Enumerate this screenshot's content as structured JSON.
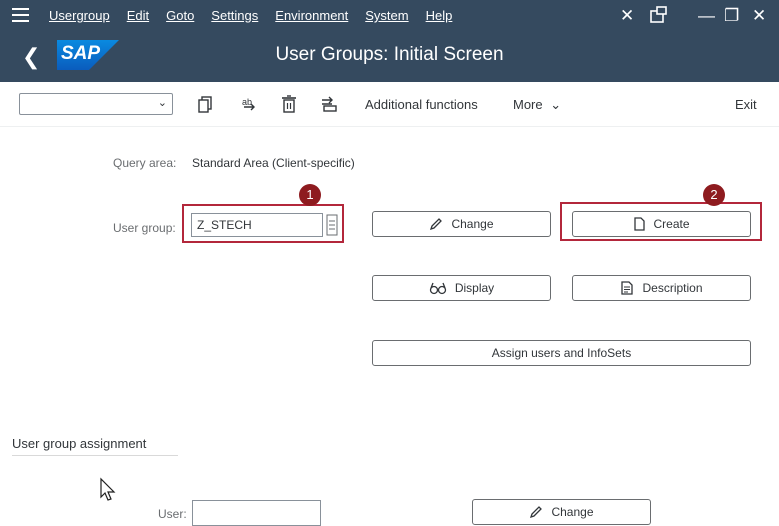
{
  "menu": {
    "items": [
      "Usergroup",
      "Edit",
      "Goto",
      "Settings",
      "Environment",
      "System",
      "Help"
    ]
  },
  "window_controls": {
    "close_glyph": "✕",
    "minimize_glyph": "—",
    "maximize_glyph": "❐",
    "exit_glyph": "✕"
  },
  "header": {
    "logo_text": "SAP",
    "title": "User Groups: Initial Screen",
    "back_glyph": "❮"
  },
  "toolbar": {
    "command_value": "",
    "additional_functions": "Additional functions",
    "more_label": "More",
    "more_chevron": "⌄",
    "exit_label": "Exit"
  },
  "main": {
    "query_area_label": "Query area:",
    "query_area_value": "Standard Area (Client-specific)",
    "user_group_label": "User group:",
    "user_group_value": "Z_STECH",
    "buttons": {
      "change": "Change",
      "create": "Create",
      "display": "Display",
      "description": "Description",
      "assign": "Assign users and InfoSets"
    },
    "badges": [
      "1",
      "2"
    ]
  },
  "assignment": {
    "section_title": "User group assignment",
    "user_label": "User:",
    "user_value": "",
    "change_label": "Change"
  },
  "colors": {
    "shell": "#354a5f",
    "highlight": "#b3273b",
    "badge": "#8e1b1f",
    "logo": "#0a6ed1"
  }
}
